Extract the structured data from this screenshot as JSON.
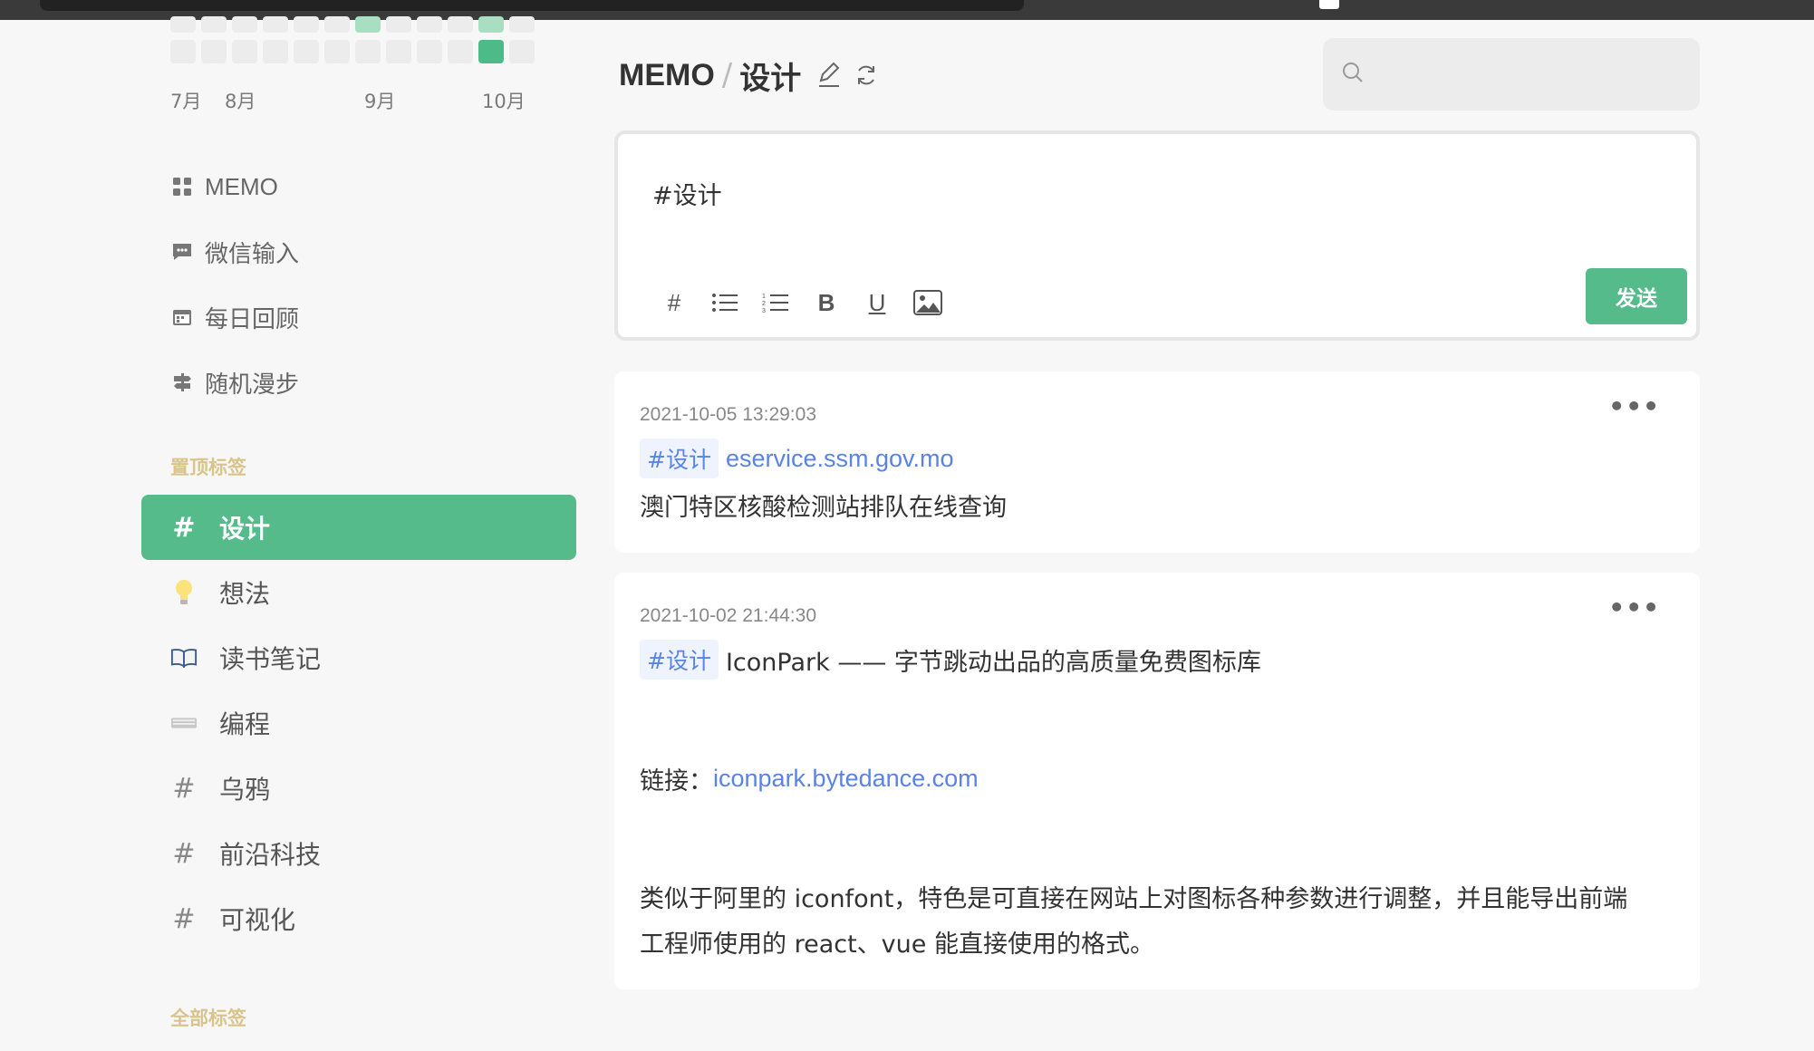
{
  "heatmap": {
    "row1": [
      0,
      0,
      0,
      0,
      0,
      0,
      1,
      0,
      0,
      0,
      1,
      0
    ],
    "row2": [
      0,
      0,
      0,
      0,
      0,
      0,
      0,
      0,
      0,
      0,
      3,
      0
    ],
    "months": [
      "7月",
      "8月",
      "9月",
      "10月"
    ]
  },
  "sidebar": {
    "nav": [
      {
        "label": "MEMO",
        "icon": "grid-icon"
      },
      {
        "label": "微信输入",
        "icon": "chat-icon"
      },
      {
        "label": "每日回顾",
        "icon": "calendar-icon"
      },
      {
        "label": "随机漫步",
        "icon": "signpost-icon"
      }
    ],
    "pinned_title": "置顶标签",
    "pinned_tags": [
      {
        "label": "设计",
        "icon": "hash-icon",
        "active": true
      },
      {
        "label": "想法",
        "icon": "lightbulb-icon"
      },
      {
        "label": "读书笔记",
        "icon": "book-icon"
      },
      {
        "label": "编程",
        "icon": "keyboard-icon"
      },
      {
        "label": "乌鸦",
        "icon": "hash-icon"
      },
      {
        "label": "前沿科技",
        "icon": "hash-icon"
      },
      {
        "label": "可视化",
        "icon": "hash-icon"
      }
    ],
    "all_tags_title": "全部标签"
  },
  "header": {
    "root": "MEMO",
    "separator": "/",
    "current": "设计",
    "search_placeholder": ""
  },
  "editor": {
    "content": "#设计",
    "tools": [
      "#",
      "U"
    ],
    "bold_label": "B",
    "send_label": "发送"
  },
  "memos": [
    {
      "time": "2021-10-05 13:29:03",
      "tag": "#设计",
      "link": "eservice.ssm.gov.mo",
      "text": "澳门特区核酸检测站排队在线查询"
    },
    {
      "time": "2021-10-02 21:44:30",
      "tag": "#设计",
      "title": "IconPark —— 字节跳动出品的高质量免费图标库",
      "link_label": "链接：",
      "link": "iconpark.bytedance.com",
      "desc1": "类似于阿里的 iconfont，特色是可直接在网站上对图标各种参数进行调整，并且能导出前端",
      "desc2": "工程师使用的 react、vue 能直接使用的格式。"
    }
  ],
  "colors": {
    "accent": "#55bb8a",
    "link": "#5a83e6",
    "section_title": "#d9c48c",
    "heat_light": "#a8dfc2",
    "heat_strong": "#4dbb87"
  }
}
